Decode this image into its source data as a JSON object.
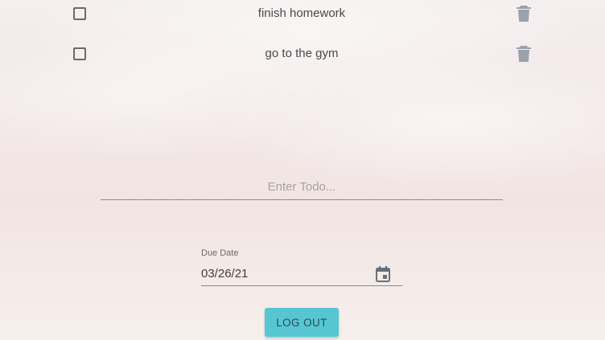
{
  "todos": [
    {
      "text": "finish homework",
      "checked": false
    },
    {
      "text": "go to the gym",
      "checked": false
    }
  ],
  "todo_input": {
    "placeholder": "Enter Todo...",
    "value": ""
  },
  "due_date": {
    "label": "Due Date",
    "value": "03/26/21"
  },
  "logout_label": "LOG OUT",
  "icons": {
    "checkbox": "checkbox-blank-icon",
    "delete": "trash-icon",
    "date": "calendar-icon"
  },
  "colors": {
    "accent": "#56c6d3",
    "icon": "#9aa1ab"
  }
}
